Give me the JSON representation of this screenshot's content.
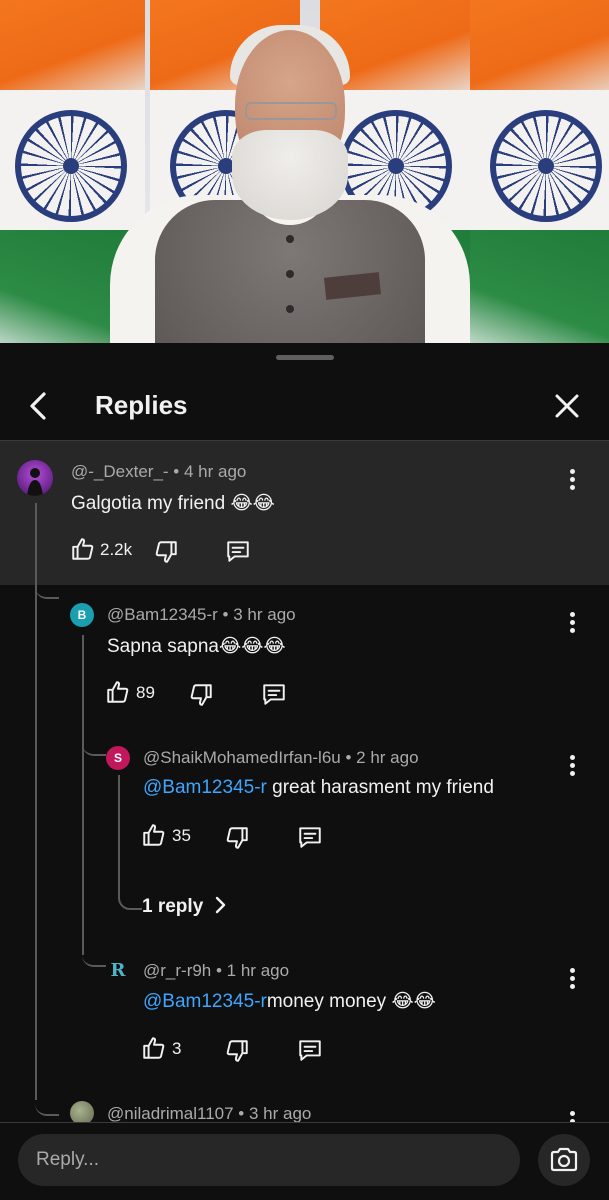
{
  "header": {
    "title": "Replies"
  },
  "comments": [
    {
      "handle": "@-_Dexter_-",
      "time": "4 hr ago",
      "text": "Galgotia my friend",
      "emoji": "😂😂",
      "likes": "2.2k",
      "avatar_color": "#6a2a8a"
    },
    {
      "handle": "@Bam12345-r",
      "time": "3 hr ago",
      "text": "Sapna sapna",
      "emoji": "😂😂😂",
      "likes": "89",
      "avatar_letter": "B",
      "avatar_color": "#1a9fb0"
    },
    {
      "handle": "@ShaikMohamedIrfan-l6u",
      "time": "2 hr ago",
      "mention": "@Bam12345-r",
      "text": " great harasment my friend",
      "likes": "35",
      "avatar_letter": "S",
      "avatar_color": "#c2185b",
      "replies_label": "1 reply"
    },
    {
      "handle": "@r_r-r9h",
      "time": "1 hr ago",
      "mention": "@Bam12345-r",
      "text": "money money",
      "emoji": "😂😂",
      "likes": "3",
      "avatar_letter": "R",
      "avatar_color": "#0f0f0f"
    },
    {
      "handle": "@niladrimal1107",
      "time": "3 hr ago",
      "avatar_color": "#6f7a5e"
    }
  ],
  "bottom": {
    "placeholder": "Reply..."
  },
  "colors": {
    "mention": "#3ea6ff",
    "highlight": "#272727",
    "background": "#0f0f0f"
  }
}
